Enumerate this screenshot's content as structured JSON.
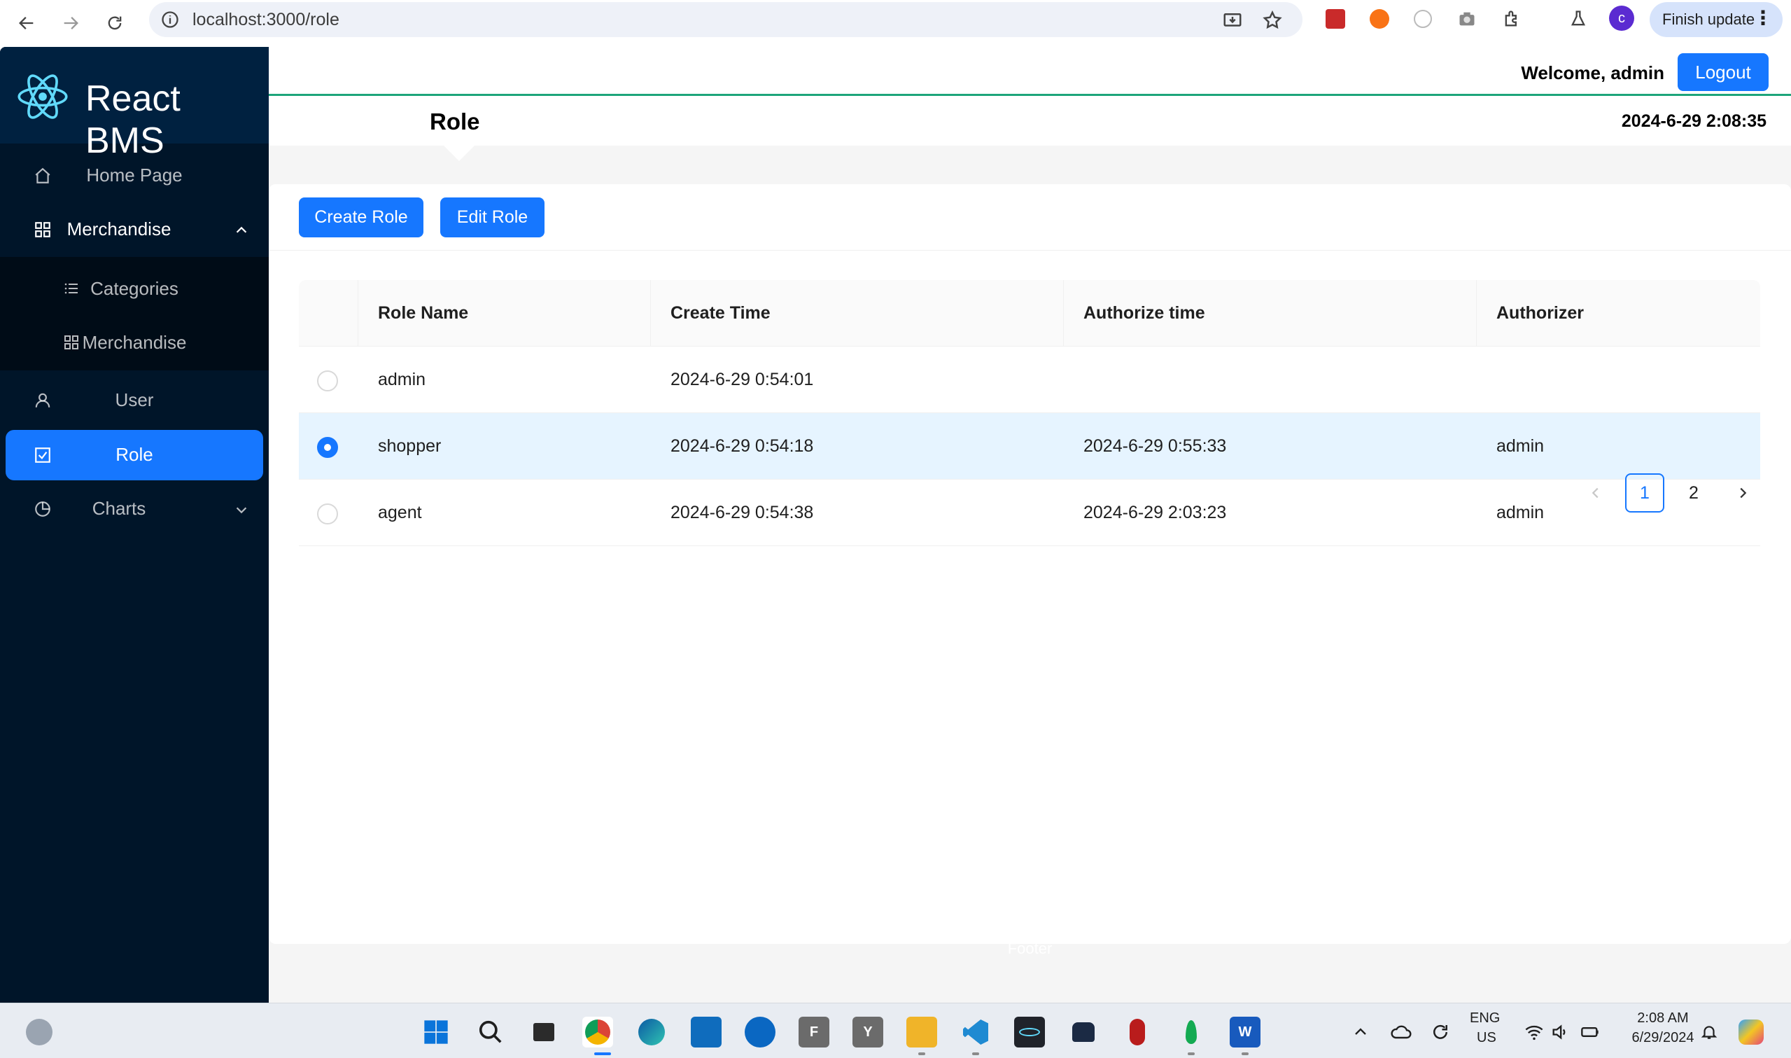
{
  "browser": {
    "url": "localhost:3000/role",
    "finish_update_label": "Finish update",
    "profile_initial": "c"
  },
  "sidebar": {
    "logo_title": "React BMS",
    "items": [
      {
        "label": "Home Page",
        "icon": "home-icon"
      },
      {
        "label": "Merchandise",
        "icon": "appstore-icon",
        "expanded": true
      },
      {
        "label": "Categories",
        "icon": "bars-icon"
      },
      {
        "label": "Merchandise",
        "icon": "appstore-icon"
      },
      {
        "label": "User",
        "icon": "user-icon"
      },
      {
        "label": "Role",
        "icon": "check-square-icon",
        "selected": true
      },
      {
        "label": "Charts",
        "icon": "pie-chart-icon",
        "expanded": false
      }
    ]
  },
  "header": {
    "welcome": "Welcome, admin",
    "logout_label": "Logout",
    "page_title": "Role",
    "datetime": "2024-6-29 2:08:35"
  },
  "toolbar": {
    "create_label": "Create Role",
    "edit_label": "Edit Role"
  },
  "table": {
    "columns": [
      "Role Name",
      "Create Time",
      "Authorize time",
      "Authorizer"
    ],
    "rows": [
      {
        "name": "admin",
        "create_time": "2024-6-29 0:54:01",
        "authorize_time": "",
        "authorizer": "",
        "selected": false
      },
      {
        "name": "shopper",
        "create_time": "2024-6-29 0:54:18",
        "authorize_time": "2024-6-29 0:55:33",
        "authorizer": "admin",
        "selected": true
      },
      {
        "name": "agent",
        "create_time": "2024-6-29 0:54:38",
        "authorize_time": "2024-6-29 2:03:23",
        "authorizer": "admin",
        "selected": false
      }
    ]
  },
  "pagination": {
    "pages": [
      "1",
      "2"
    ],
    "current": "1"
  },
  "footer": {
    "text": "Footer"
  },
  "taskbar": {
    "lang_top": "ENG",
    "lang_bottom": "US",
    "time": "2:08 AM",
    "date": "6/29/2024"
  },
  "colors": {
    "primary": "#1677ff",
    "sidebar_bg": "#001529",
    "header_line": "#1da57a"
  }
}
